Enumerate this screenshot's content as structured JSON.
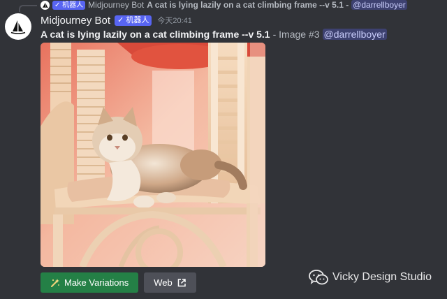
{
  "reply": {
    "bot_tag": "✓ 机器人",
    "author": "Midjourney Bot",
    "text": "A cat is lying lazily on a cat climbing frame --v 5.1 -",
    "mention": "@darrellboyer"
  },
  "message": {
    "author": "Midjourney Bot",
    "bot_tag": "✓ 机器人",
    "timestamp": "今天20:41",
    "prompt": "A cat is lying lazily on a cat climbing frame --v 5.1",
    "suffix": "- Image #3",
    "mention": "@darrellboyer"
  },
  "image": {
    "subject": "cat lying on cat climbing frame"
  },
  "buttons": {
    "make_variations": "Make Variations",
    "web": "Web"
  },
  "watermark": {
    "text": "Vicky Design Studio"
  },
  "colors": {
    "background": "#313338",
    "bot_tag": "#5865f2",
    "primary_button": "#248046",
    "secondary_button": "#4e5058"
  }
}
